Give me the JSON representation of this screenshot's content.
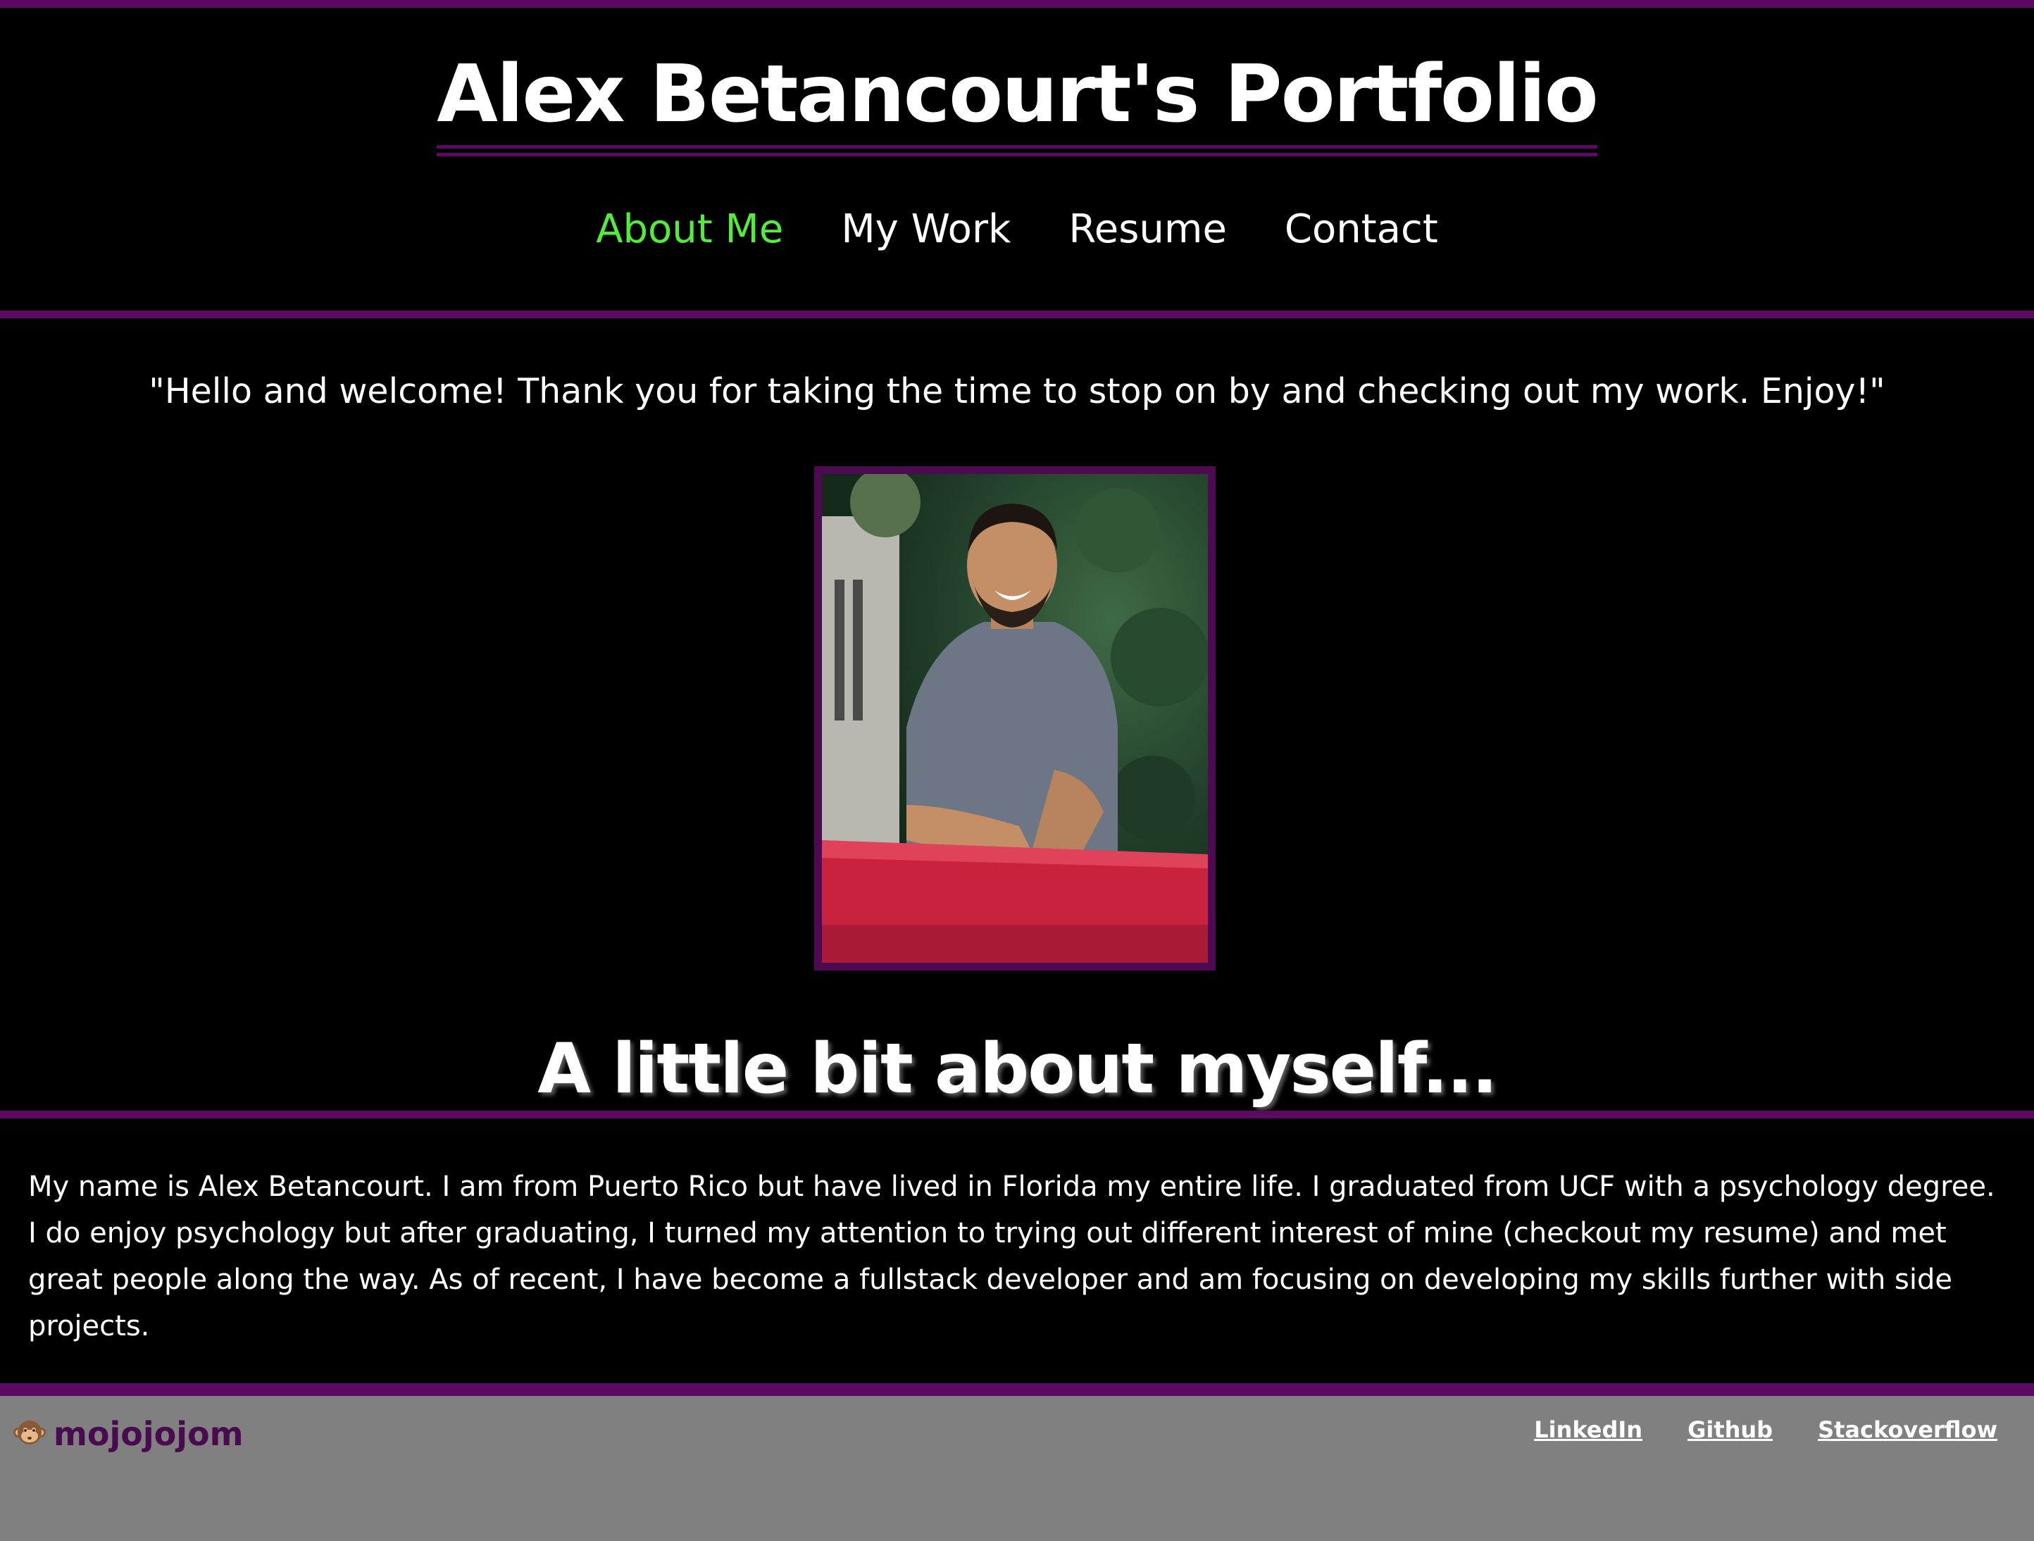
{
  "header": {
    "title": "Alex Betancourt's Portfolio",
    "nav": [
      {
        "label": "About Me",
        "active": true
      },
      {
        "label": "My Work",
        "active": false
      },
      {
        "label": "Resume",
        "active": false
      },
      {
        "label": "Contact",
        "active": false
      }
    ]
  },
  "main": {
    "welcome": "\"Hello and welcome! Thank you for taking the time to stop on by and checking out my work. Enjoy!\"",
    "photo_icon": "profile-photo",
    "heading": "A little bit about myself...",
    "bio": "My name is Alex Betancourt. I am from Puerto Rico but have lived in Florida my entire life. I graduated from UCF with a psychology degree. I do enjoy psychology but after graduating, I turned my attention to trying out different interest of mine (checkout my resume) and met great people along the way. As of recent, I have become a fullstack developer and am focusing on developing my skills further with side projects."
  },
  "footer": {
    "brand_icon": "monkey-icon",
    "brand": "mojojojom",
    "links": [
      "LinkedIn",
      "Github",
      "Stackoverflow"
    ]
  },
  "colors": {
    "accent": "#5c0a61",
    "active_nav": "#51ed38",
    "background": "#000000",
    "footer_bg": "#808080"
  }
}
